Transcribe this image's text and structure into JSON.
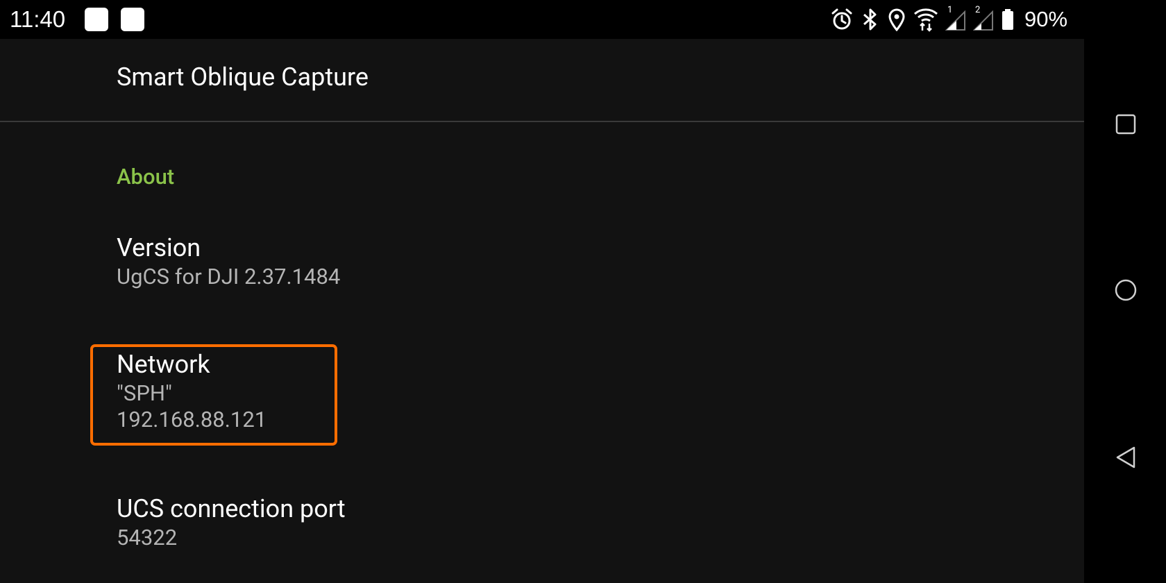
{
  "status_bar": {
    "time": "11:40",
    "battery_percent": "90%",
    "icons": [
      "alarm-icon",
      "bluetooth-icon",
      "location-icon",
      "wifi-icon",
      "signal-sim1-icon",
      "signal-sim2-icon",
      "battery-icon"
    ],
    "sim1_label": "1",
    "sim2_label": "2"
  },
  "app": {
    "title": "Smart Oblique Capture",
    "section_header": "About",
    "accent_color": "#8bc34a",
    "highlight_color": "#ff6d00",
    "items": [
      {
        "title": "Version",
        "summary": "UgCS for DJI 2.37.1484"
      },
      {
        "title": "Network",
        "summary_line1": "\"SPH\"",
        "summary_line2": "192.168.88.121"
      },
      {
        "title": "UCS connection port",
        "summary": "54322"
      }
    ]
  },
  "nav_bar": {
    "buttons": [
      "recents-button",
      "home-button",
      "back-button"
    ]
  }
}
